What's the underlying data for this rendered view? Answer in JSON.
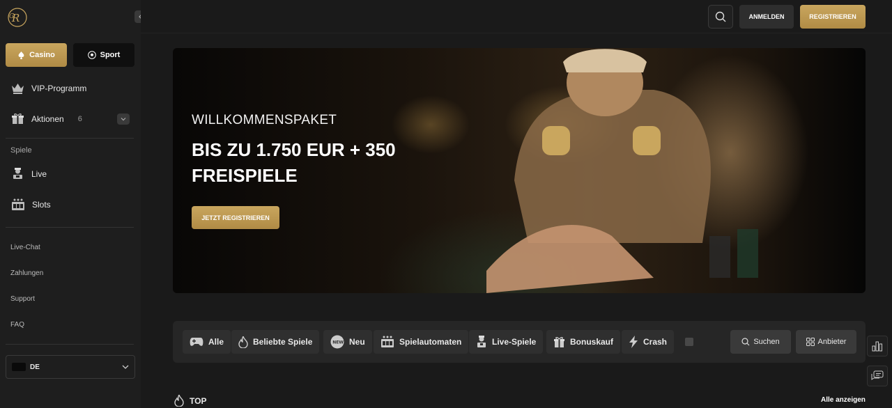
{
  "sidebar": {
    "modes": {
      "casino": "Casino",
      "sport": "Sport"
    },
    "vip": "VIP-Programm",
    "promotions": {
      "label": "Aktionen",
      "count": "6"
    },
    "games_section": "Spiele",
    "live": "Live",
    "slots": "Slots",
    "links": [
      "Live-Chat",
      "Zahlungen",
      "Support",
      "FAQ"
    ],
    "language": "DE"
  },
  "header": {
    "login": "ANMELDEN",
    "register": "REGISTRIEREN"
  },
  "hero": {
    "title": "WILLKOMMENSPAKET",
    "headline_line1": "BIS ZU 1.750 EUR + 350",
    "headline_line2": "FREISPIELE",
    "cta": "JETZT REGISTRIEREN"
  },
  "categories": [
    {
      "label": "Alle",
      "icon": "gamepad-icon"
    },
    {
      "label": "Beliebte Spiele",
      "icon": "fire-icon"
    },
    {
      "label": "Neu",
      "icon": "new-badge-icon"
    },
    {
      "label": "Spielautomaten",
      "icon": "slot-machine-icon"
    },
    {
      "label": "Live-Spiele",
      "icon": "dealer-icon"
    },
    {
      "label": "Bonuskauf",
      "icon": "gift-icon"
    },
    {
      "label": "Crash",
      "icon": "lightning-icon"
    }
  ],
  "tools": {
    "search": "Suchen",
    "providers": "Anbieter"
  },
  "top_section": {
    "label": "TOP",
    "see_all": "Alle anzeigen"
  },
  "colors": {
    "gold": "#c9a65e",
    "bg": "#1a1a1a",
    "sidebar": "#1e1e1e"
  }
}
